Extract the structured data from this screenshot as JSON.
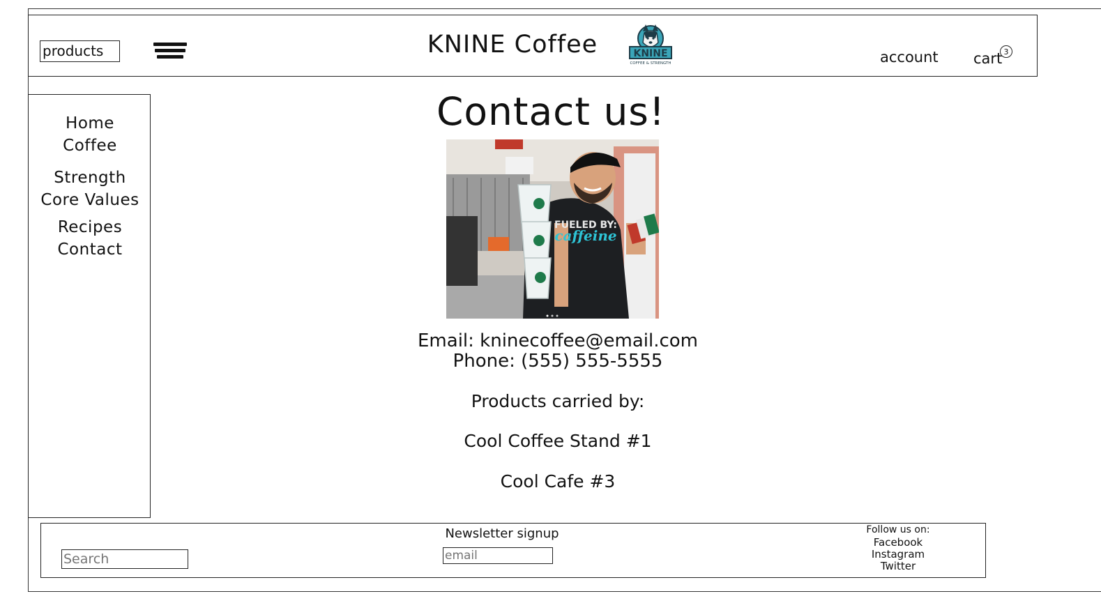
{
  "header": {
    "products_label": "products",
    "site_title": "KNINE Coffee",
    "logo_text": "KNINE",
    "logo_subtext": "COFFEE & STRENGTH",
    "account_label": "account",
    "cart_label": "cart",
    "cart_count": "3"
  },
  "sidebar": {
    "items": [
      {
        "label": "Home"
      },
      {
        "label": "Coffee"
      },
      {
        "label": "Strength"
      },
      {
        "label": "Core Values"
      },
      {
        "label": "Recipes"
      },
      {
        "label": "Contact"
      }
    ]
  },
  "main": {
    "title": "Contact us!",
    "photo_shirt_text": "FUELED BY:",
    "photo_shirt_script": "caffeine",
    "email_line": "Email: kninecoffee@email.com",
    "phone_line": "Phone: (555) 555-5555",
    "carried_heading": "Products carried by:",
    "stores": [
      "Cool Coffee Stand #1",
      "Cool Cafe #3"
    ]
  },
  "footer": {
    "search_placeholder": "Search",
    "newsletter_label": "Newsletter signup",
    "email_placeholder": "email",
    "follow_label": "Follow us on:",
    "social": [
      "Facebook",
      "Instagram",
      "Twitter"
    ]
  },
  "colors": {
    "border": "#222222",
    "logo_teal": "#3aa6b9",
    "shirt_text": "#2ec4d6"
  },
  "icons": {
    "menu": "hamburger-icon",
    "logo": "husky-logo-icon"
  }
}
